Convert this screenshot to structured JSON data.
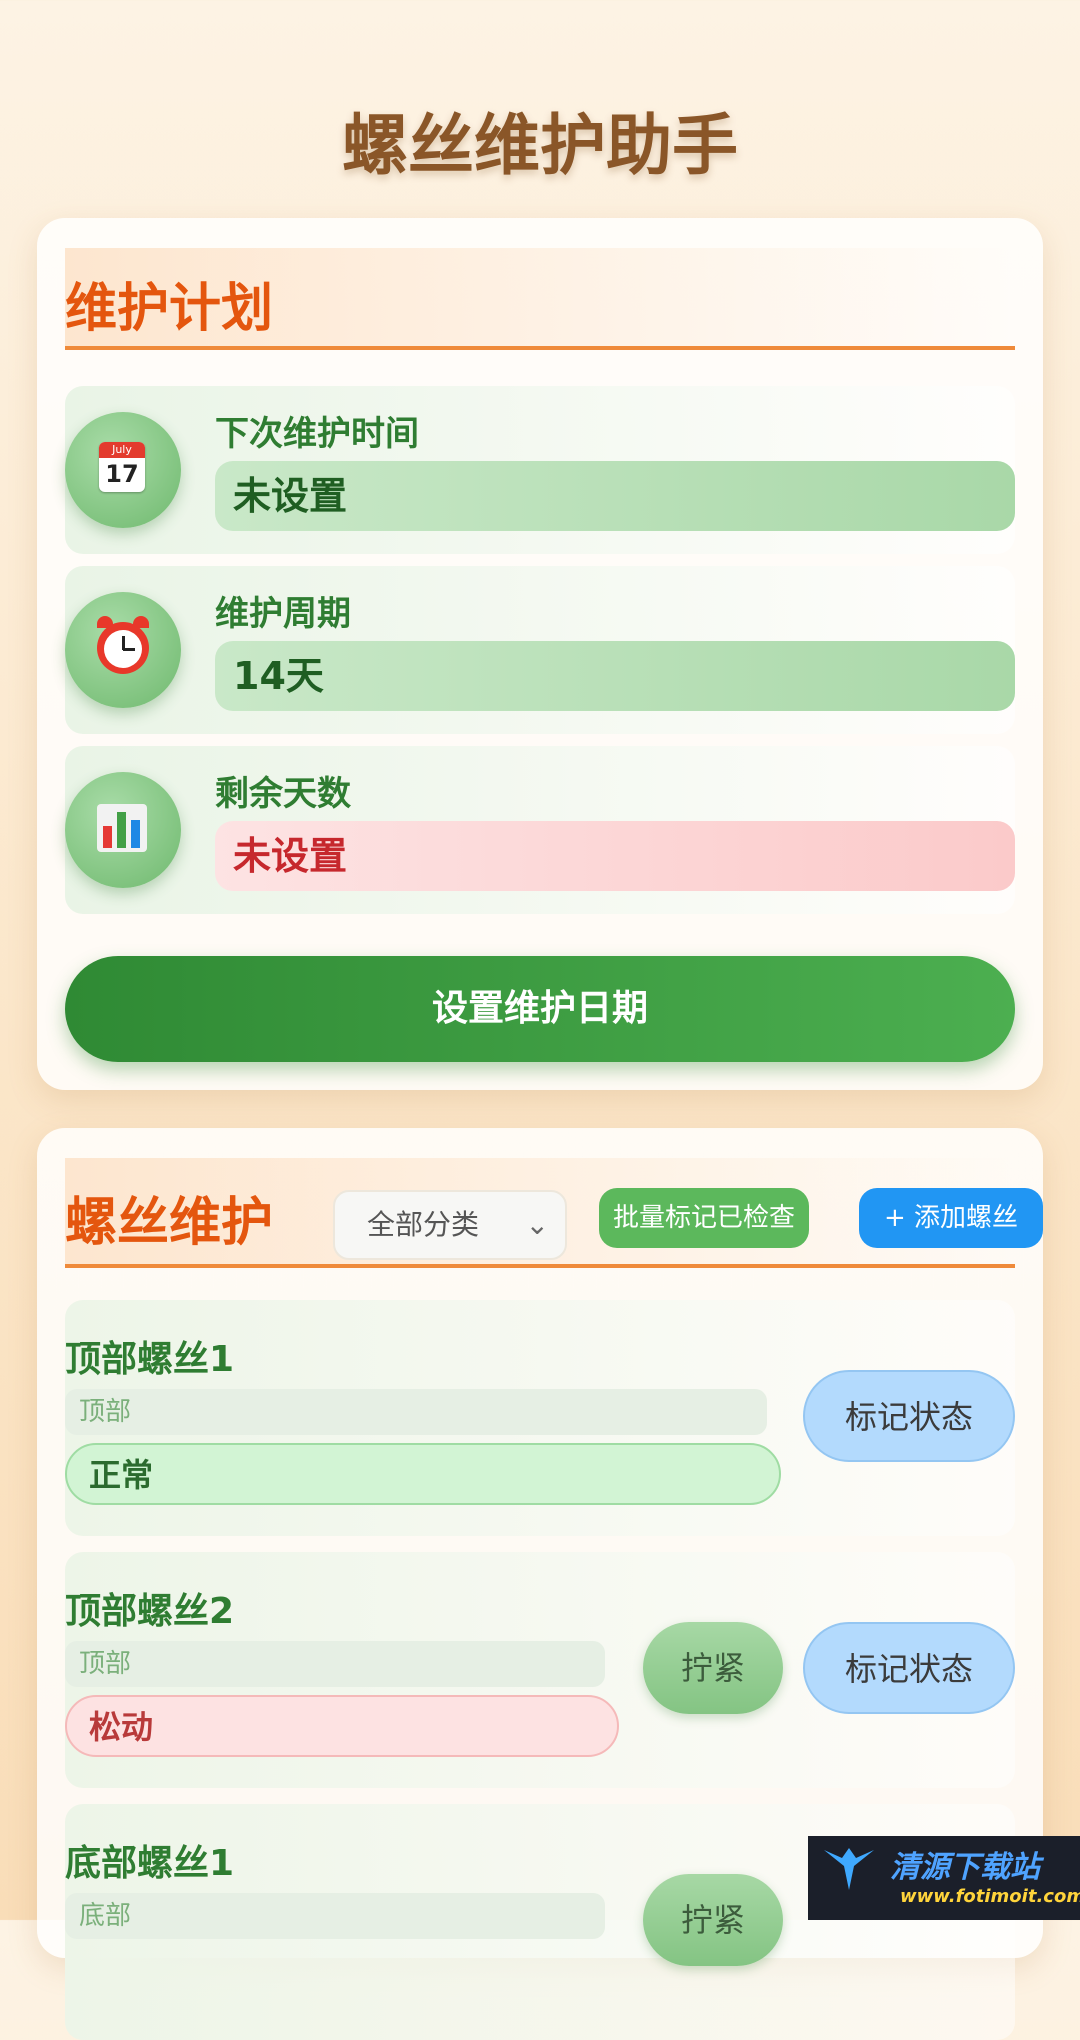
{
  "header": {
    "title": "螺丝维护助手"
  },
  "plan": {
    "title": "维护计划",
    "rows": [
      {
        "icon": "calendar-icon",
        "label": "下次维护时间",
        "value": "未设置",
        "tone": "green"
      },
      {
        "icon": "alarm-clock-icon",
        "label": "维护周期",
        "value": "14天",
        "tone": "green"
      },
      {
        "icon": "bar-chart-icon",
        "label": "剩余天数",
        "value": "未设置",
        "tone": "red"
      }
    ],
    "calendar_month": "July",
    "calendar_day": "17",
    "set_button": "设置维护日期"
  },
  "screws": {
    "title": "螺丝维护",
    "filter": {
      "selected": "全部分类"
    },
    "batch_button": "批量标记已检查",
    "add_button": "+ 添加螺丝",
    "items": [
      {
        "name": "顶部螺丝1",
        "category": "顶部",
        "status": "正常",
        "status_type": "normal",
        "has_tighten": false,
        "mark_label": "标记状态"
      },
      {
        "name": "顶部螺丝2",
        "category": "顶部",
        "status": "松动",
        "status_type": "loose",
        "has_tighten": true,
        "tighten_label": "拧紧",
        "mark_label": "标记状态"
      },
      {
        "name": "底部螺丝1",
        "category": "底部",
        "status": "",
        "status_type": "loose",
        "has_tighten": true,
        "tighten_label": "拧紧",
        "mark_label": ""
      }
    ]
  },
  "watermark": {
    "text": "清源下载站",
    "url": "www.fotimoit.com"
  },
  "colors": {
    "accent_orange": "#e4560e",
    "green_text": "#2f7d32",
    "primary_green": "#2f8a34",
    "blue": "#2196f3"
  }
}
